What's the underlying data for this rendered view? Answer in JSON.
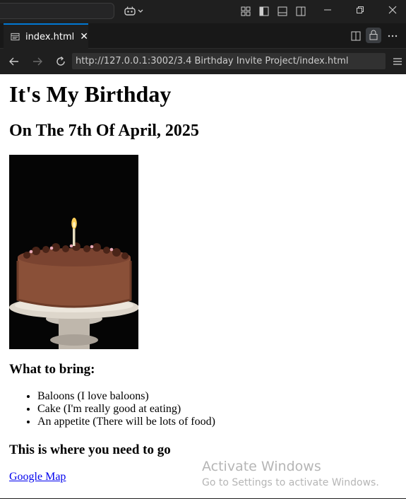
{
  "editor": {
    "tab": {
      "label": "index.html",
      "close": "✕"
    },
    "url": "http://127.0.0.1:3002/3.4 Birthday Invite Project/index.html"
  },
  "page": {
    "title": "It's My Birthday",
    "date": "On The 7th Of April, 2025",
    "bring_heading": "What to bring:",
    "bring_items": [
      "Baloons (I love baloons)",
      "Cake (I'm really good at eating)",
      "An appetite (There will be lots of food)"
    ],
    "where_heading": "This is where you need to go",
    "map_link": "Google Map"
  },
  "watermark": {
    "line1": "Activate Windows",
    "line2": "Go to Settings to activate Windows."
  },
  "colors": {
    "accent": "#0078d4",
    "link": "#0000ee",
    "chrome_bg": "#1f1f1f"
  }
}
